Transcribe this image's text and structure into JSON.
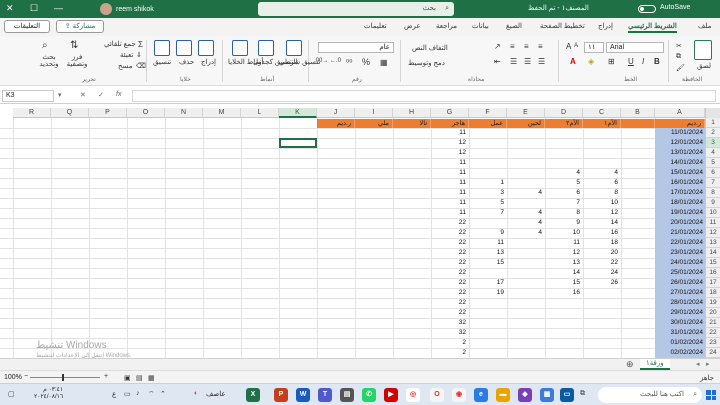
{
  "titlebar": {
    "user": "reem shikok",
    "search_placeholder": "بحث",
    "doc_name": "المصنف١ - تم الحفظ",
    "autosave": "AutoSave",
    "minimize": "—",
    "maximize": "☐",
    "close": "✕"
  },
  "tabs": [
    "ملف",
    "الشريط الرئيسي",
    "إدراج",
    "تخطيط الصفحة",
    "الصيغ",
    "بيانات",
    "مراجعة",
    "عرض",
    "تعليمات"
  ],
  "active_tab": "الشريط الرئيسي",
  "buttons": {
    "share": "مشاركة",
    "comments": "التعليقات"
  },
  "ribbon": {
    "clipboard": {
      "paste": "لصق",
      "label": "الحافظة"
    },
    "font": {
      "name": "Arial",
      "size": "١١",
      "label": "الخط"
    },
    "alignment": {
      "wrap": "التفاف النص",
      "merge": "دمج وتوسيط",
      "label": "محاذاة"
    },
    "number": {
      "format": "عام",
      "percent": "%",
      "label": "رقم"
    },
    "styles": {
      "conditional": "تنسيق شرطي",
      "table": "التنسيق كجدول",
      "cell_styles": "أنماط الخلايا",
      "label": "أنماط"
    },
    "cells": {
      "insert": "إدراج",
      "delete": "حذف",
      "format": "تنسيق",
      "label": "خلايا"
    },
    "editing": {
      "autosum": "جمع تلقائي",
      "fill": "تعبئة",
      "clear": "مسح",
      "sort": "فرز وتصفية",
      "find": "بحث وتحديد",
      "label": "تحرير"
    }
  },
  "formula_bar": {
    "name_box": "K3",
    "cancel": "✕",
    "enter": "✓",
    "fx": "fx",
    "value": ""
  },
  "columns": [
    "A",
    "B",
    "C",
    "D",
    "E",
    "F",
    "G",
    "H",
    "I",
    "J",
    "K",
    "L",
    "M",
    "N",
    "O",
    "P",
    "Q",
    "R"
  ],
  "selected_column": "K",
  "rows": [
    "1",
    "2",
    "3",
    "4",
    "5",
    "6",
    "7",
    "8",
    "9",
    "10",
    "11",
    "12",
    "13",
    "14",
    "15",
    "16",
    "17",
    "18",
    "19",
    "20",
    "21",
    "22",
    "23",
    "24"
  ],
  "selected_row": "3",
  "header_row": {
    "A": "ر.ديم",
    "B": "",
    "C": "الأم١",
    "D": "الأم٢",
    "E": "لحين",
    "F": "عمل",
    "G": "هاجر",
    "H": "تالا",
    "I": "ملي",
    "J": "ر.ديم"
  },
  "dates": [
    "11/01/2024",
    "12/01/2024",
    "13/01/2024",
    "14/01/2024",
    "15/01/2024",
    "16/01/2024",
    "17/01/2024",
    "18/01/2024",
    "19/01/2024",
    "20/01/2024",
    "21/01/2024",
    "22/01/2024",
    "23/01/2024",
    "24/01/2024",
    "25/01/2024",
    "26/01/2024",
    "27/01/2024",
    "28/01/2024",
    "29/01/2024",
    "30/01/2024",
    "31/01/2024",
    "01/02/2024",
    "02/02/2024"
  ],
  "col_C": [
    "",
    "",
    "",
    "",
    "4",
    "6",
    "8",
    "10",
    "12",
    "14",
    "16",
    "18",
    "20",
    "22",
    "24",
    "26",
    "",
    "",
    "",
    "",
    "",
    "",
    ""
  ],
  "col_D": [
    "",
    "",
    "",
    "",
    "4",
    "5",
    "6",
    "7",
    "8",
    "9",
    "10",
    "11",
    "12",
    "13",
    "14",
    "15",
    "16",
    "",
    "",
    "",
    "",
    "",
    ""
  ],
  "col_E": [
    "",
    "",
    "",
    "",
    "",
    "",
    "4",
    "",
    "4",
    "4",
    "4",
    "",
    "",
    "",
    "",
    "",
    "",
    "",
    "",
    "",
    "",
    "",
    ""
  ],
  "col_F": [
    "",
    "",
    "",
    "",
    "",
    "1",
    "3",
    "5",
    "7",
    "",
    "9",
    "11",
    "13",
    "15",
    "",
    "17",
    "19",
    "",
    "",
    "",
    "",
    "",
    ""
  ],
  "col_G": [
    "11",
    "12",
    "12",
    "11",
    "11",
    "11",
    "11",
    "11",
    "11",
    "22",
    "22",
    "22",
    "22",
    "22",
    "22",
    "22",
    "22",
    "22",
    "22",
    "32",
    "32",
    "2",
    "2"
  ],
  "sheet_tab": "ورقة١",
  "status": {
    "zoom": "100%",
    "ready": "جاهز"
  },
  "watermark": {
    "title": "تنشيط Windows",
    "subtitle": "انتقل إلى الإعدادات لتنشيط Windows."
  },
  "taskbar": {
    "search_placeholder": "اكتب هنا للبحث",
    "weather": "عاصف",
    "time": "٠٣:٤١ م",
    "date": "٢٠٢٤/٠٨/١٦",
    "apps": [
      "X",
      "P",
      "W",
      "T",
      "S"
    ]
  },
  "colors": {
    "excel_green": "#1f7145",
    "header_orange": "#ed7d31",
    "date_blue": "#b4c7e7"
  }
}
